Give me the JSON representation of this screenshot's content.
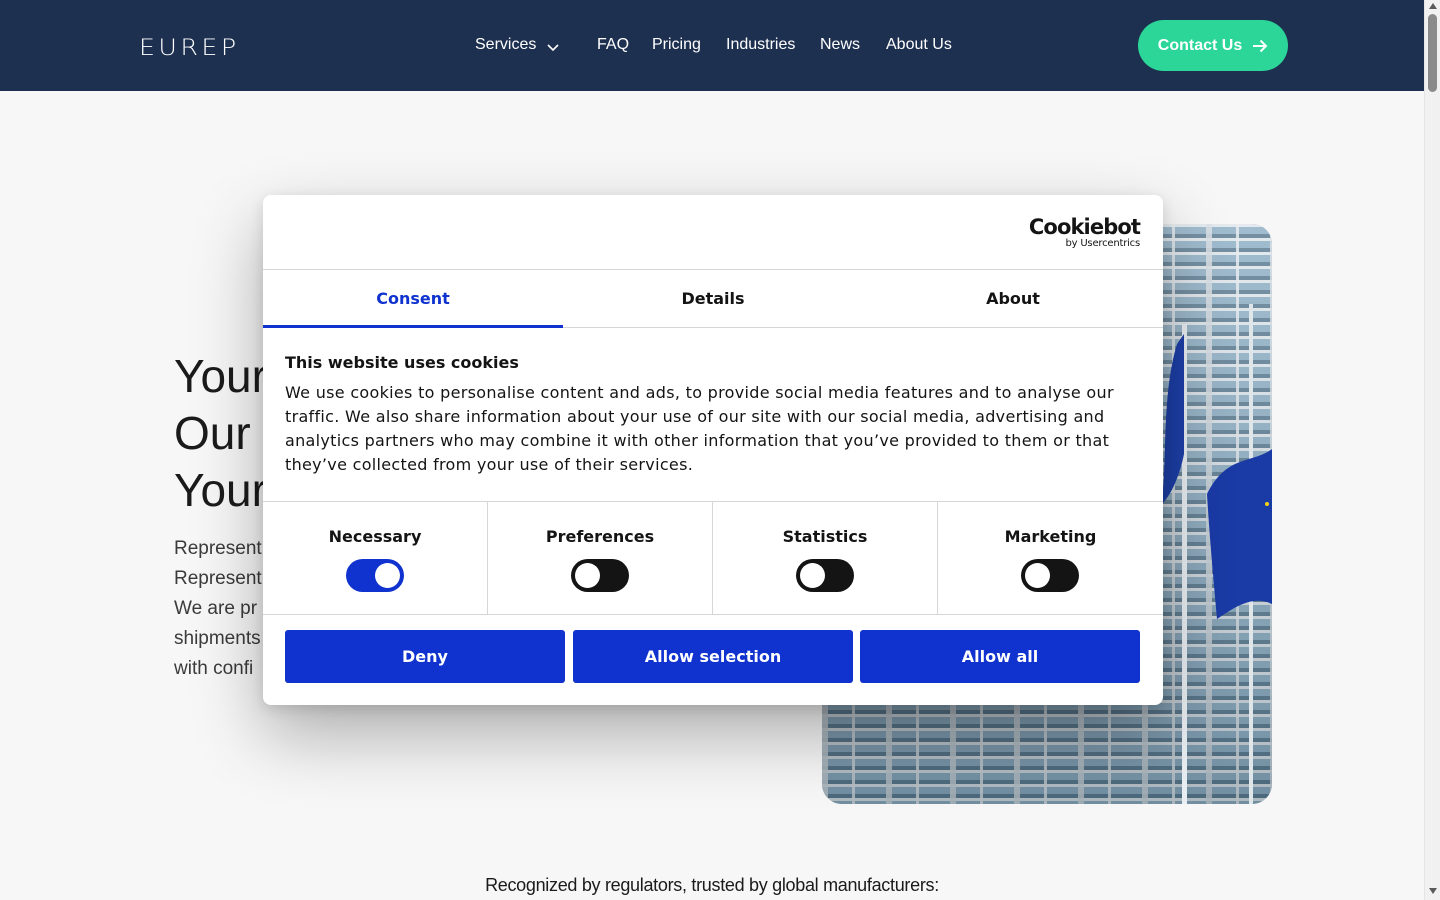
{
  "header": {
    "logo": "EUREP",
    "nav": [
      {
        "label": "Services",
        "has_dropdown": true
      },
      {
        "label": "FAQ"
      },
      {
        "label": "Pricing"
      },
      {
        "label": "Industries"
      },
      {
        "label": "News"
      },
      {
        "label": "About Us"
      }
    ],
    "contact_label": "Contact Us",
    "background_color": "#1e3050",
    "accent_color": "#2bd698"
  },
  "hero": {
    "title_lines": [
      "Your",
      "Our",
      "Your"
    ],
    "text_lines": [
      "Represent",
      "Represent",
      "We are pr",
      "shipments",
      "with confi"
    ]
  },
  "recognized_text": "Recognized by regulators, trusted by global manufacturers:",
  "cookie_dialog": {
    "brand": "Cookiebot",
    "brand_sub": "by Usercentrics",
    "tabs": [
      "Consent",
      "Details",
      "About"
    ],
    "active_tab": "Consent",
    "heading": "This website uses cookies",
    "body_lines": [
      "We use cookies to personalise content and ads, to provide social media features and to analyse our",
      "traffic. We also share information about your use of our site with our social media, advertising and",
      "analytics partners who may combine it with other information that you’ve provided to them or that",
      "they’ve collected from your use of their services."
    ],
    "categories": [
      {
        "label": "Necessary",
        "enabled": true
      },
      {
        "label": "Preferences",
        "enabled": false
      },
      {
        "label": "Statistics",
        "enabled": false
      },
      {
        "label": "Marketing",
        "enabled": false
      }
    ],
    "buttons": {
      "deny": "Deny",
      "allow_selection": "Allow selection",
      "allow_all": "Allow all"
    },
    "accent_color": "#1032cf"
  }
}
